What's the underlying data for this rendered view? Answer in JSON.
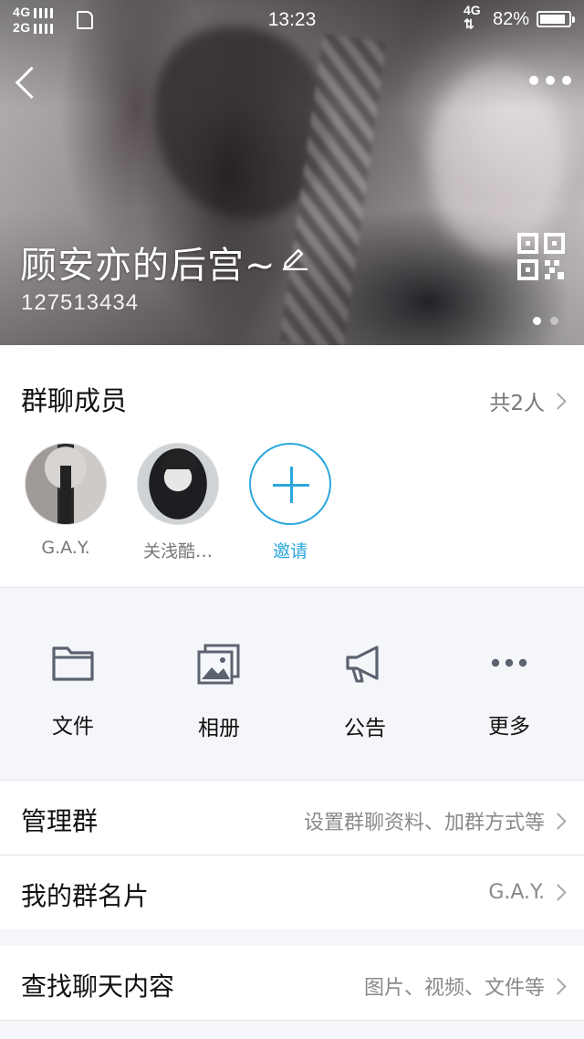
{
  "status_bar": {
    "signal_top": "4G",
    "signal_bottom": "2G",
    "time": "13:23",
    "net": "4G",
    "battery": "82%"
  },
  "header": {
    "group_name": "顾安亦的后宫~",
    "group_id": "127513434"
  },
  "members": {
    "title": "群聊成员",
    "count_label": "共2人",
    "list": [
      {
        "name": "G.A.Y."
      },
      {
        "name": "关浅酷…"
      }
    ],
    "invite_label": "邀请"
  },
  "tools": [
    {
      "icon": "folder-icon",
      "label": "文件"
    },
    {
      "icon": "album-icon",
      "label": "相册"
    },
    {
      "icon": "megaphone-icon",
      "label": "公告"
    },
    {
      "icon": "more-dots-icon",
      "label": "更多"
    }
  ],
  "rows": [
    {
      "key": "管理群",
      "value": "设置群聊资料、加群方式等"
    },
    {
      "key": "我的群名片",
      "value": "G.A.Y."
    },
    {
      "key": "查找聊天内容",
      "value": "图片、视频、文件等"
    }
  ],
  "colors": {
    "accent": "#2ba8dd",
    "icon": "#5b6370"
  }
}
